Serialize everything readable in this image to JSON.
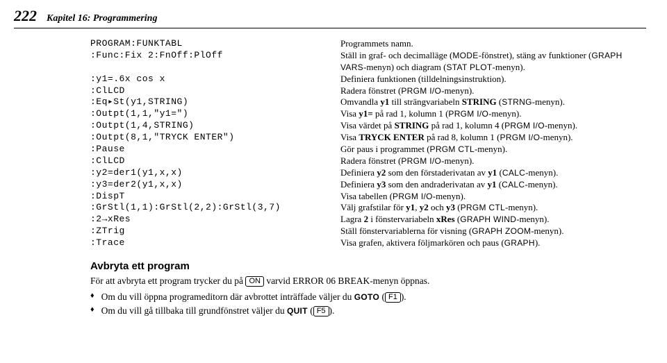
{
  "header": {
    "page_num": "222",
    "chapter": "Kapitel 16: Programmering"
  },
  "table": {
    "rows": [
      {
        "code": "PROGRAM:FUNKTABL",
        "desc_plain": "Programmets namn."
      },
      {
        "code": ":Func:Fix 2:FnOff:PlOff",
        "desc_html": "Ställ in graf- och decimalläge (<span class='sc'>MODE</span>-fönstret), stäng av funktioner (<span class='sc'>GRAPH VARS</span>-menyn) och diagram (<span class='sc'>STAT PLOT</span>-menyn)."
      },
      {
        "code": ":y1=.6x cos x",
        "desc_plain": "Definiera funktionen (tilldelningsinstruktion)."
      },
      {
        "code": ":ClLCD",
        "desc_html": "Radera fönstret (<span class='sc'>PRGM I/O</span>-menyn)."
      },
      {
        "code": ":Eq▸St(y1,STRING)",
        "desc_html": "Omvandla <span class='bold'>y1</span> till strängvariabeln <span class='bold'>STRING</span> (<span class='sc'>STRNG</span>-menyn)."
      },
      {
        "code": ":Outpt(1,1,\"y1=\")",
        "desc_html": "Visa <span class='bold'>y1=</span> på rad 1, kolumn 1 (<span class='sc'>PRGM I/O</span>-menyn)."
      },
      {
        "code": ":Outpt(1,4,STRING)",
        "desc_html": "Visa värdet på <span class='bold'>STRING</span> på rad 1, kolumn 4 (<span class='sc'>PRGM I/O</span>-menyn)."
      },
      {
        "code": ":Outpt(8,1,\"TRYCK ENTER\")",
        "desc_html": "Visa <span class='bold'>TRYCK ENTER</span> på rad 8, kolumn 1 (<span class='sc'>PRGM I/O</span>-menyn)."
      },
      {
        "code": ":Pause",
        "desc_html": "Gör paus i programmet (<span class='sc'>PRGM CTL</span>-menyn)."
      },
      {
        "code": ":ClLCD",
        "desc_html": "Radera fönstret (<span class='sc'>PRGM I/O</span>-menyn)."
      },
      {
        "code": ":y2=der1(y1,x,x)",
        "desc_html": "Definiera <span class='bold'>y2</span> som den förstaderivatan av <span class='bold'>y1</span> (<span class='sc'>CALC</span>-menyn)."
      },
      {
        "code": ":y3=der2(y1,x,x)",
        "desc_html": "Definiera <span class='bold'>y3</span> som den andraderivatan av <span class='bold'>y1</span> (<span class='sc'>CALC</span>-menyn)."
      },
      {
        "code": ":DispT",
        "desc_html": "Visa tabellen (<span class='sc'>PRGM I/O</span>-menyn)."
      },
      {
        "code": ":GrStl(1,1):GrStl(2,2):GrStl(3,7)",
        "desc_html": "Välj grafstilar för <span class='bold'>y1</span>, <span class='bold'>y2</span> och <span class='bold'>y3</span> (<span class='sc'>PRGM CTL</span>-menyn)."
      },
      {
        "code": ":2→xRes",
        "desc_html": "Lagra <span class='bold'>2</span> i fönstervariabeln <span class='bold'>xRes</span> (<span class='sc'>GRAPH WIND</span>-menyn)."
      },
      {
        "code": ":ZTrig",
        "desc_html": "Ställ fönstervariablerna för visning (<span class='sc'>GRAPH ZOOM</span>-menyn)."
      },
      {
        "code": ":Trace",
        "desc_html": "Visa grafen, aktivera följmarkören och paus (<span class='sc'>GRAPH</span>)."
      }
    ]
  },
  "section": {
    "title": "Avbryta ett program",
    "intro_pre": "För att avbryta ett program trycker du på ",
    "intro_key": "ON",
    "intro_post": " varvid ERROR 06 BREAK-menyn öppnas.",
    "bullets": [
      {
        "pre": "Om du vill öppna programeditorn där avbrottet inträffade väljer du ",
        "bold": "GOTO",
        "paren_pre": " (",
        "key": "F1",
        "paren_post": ")."
      },
      {
        "pre": "Om du vill gå tillbaka till grundfönstret väljer du ",
        "bold": "QUIT",
        "paren_pre": " (",
        "key": "F5",
        "paren_post": ")."
      }
    ]
  }
}
